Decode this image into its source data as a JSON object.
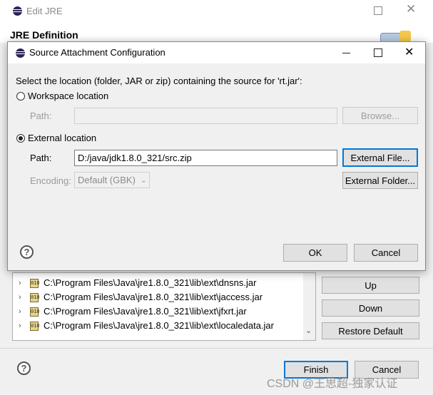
{
  "parent_window": {
    "title": "Edit JRE",
    "section_title": "JRE Definition",
    "jar_items": [
      "C:\\Program Files\\Java\\jre1.8.0_321\\lib\\ext\\dnsns.jar",
      "C:\\Program Files\\Java\\jre1.8.0_321\\lib\\ext\\jaccess.jar",
      "C:\\Program Files\\Java\\jre1.8.0_321\\lib\\ext\\jfxrt.jar",
      "C:\\Program Files\\Java\\jre1.8.0_321\\lib\\ext\\localedata.jar"
    ],
    "jar_icon_label": "010",
    "buttons": {
      "up": "Up",
      "down": "Down",
      "restore_default": "Restore Default",
      "finish": "Finish",
      "cancel": "Cancel"
    }
  },
  "dialog": {
    "title": "Source Attachment Configuration",
    "instruction": "Select the location (folder, JAR or zip) containing the source for 'rt.jar':",
    "workspace_label": "Workspace location",
    "workspace_path_label": "Path:",
    "workspace_path_value": "",
    "browse_button": "Browse...",
    "external_label": "External location",
    "external_path_label": "Path:",
    "external_path_value": "D:/java/jdk1.8.0_321/src.zip",
    "external_file_button": "External File...",
    "encoding_label": "Encoding:",
    "encoding_value": "Default (GBK)",
    "external_folder_button": "External Folder...",
    "ok_button": "OK",
    "cancel_button": "Cancel"
  },
  "watermark": "CSDN @王思超-独家认证",
  "colors": {
    "accent": "#0078d7",
    "dialog_bg": "#f0f0f0",
    "titlebar_bg": "#ffffff"
  }
}
